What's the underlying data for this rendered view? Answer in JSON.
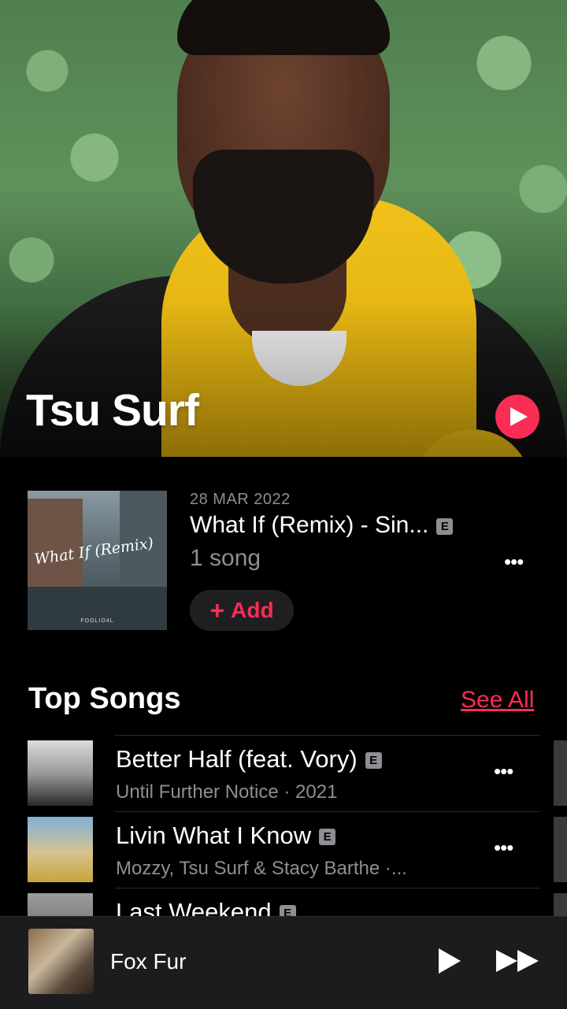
{
  "artist": {
    "name": "Tsu Surf"
  },
  "latest_release": {
    "date": "28 MAR 2022",
    "title": "What If (Remix) - Sin...",
    "explicit_badge": "E",
    "count": "1 song",
    "add_label": "Add",
    "cover_title": "What If (Remix)",
    "cover_artist": "FOOLIO4L"
  },
  "top_songs": {
    "heading": "Top Songs",
    "see_all": "See All",
    "items": [
      {
        "title": "Better Half (feat. Vory)",
        "explicit": "E",
        "subtitle": "Until Further Notice · 2021"
      },
      {
        "title": "Livin What I Know",
        "explicit": "E",
        "subtitle": "Mozzy, Tsu Surf & Stacy Barthe ·..."
      },
      {
        "title": "Last Weekend",
        "explicit": "E",
        "subtitle": ""
      }
    ]
  },
  "mini_player": {
    "title": "Fox Fur"
  },
  "colors": {
    "accent": "#fa2d55",
    "background": "#000000",
    "secondary_text": "#8e8e93"
  }
}
